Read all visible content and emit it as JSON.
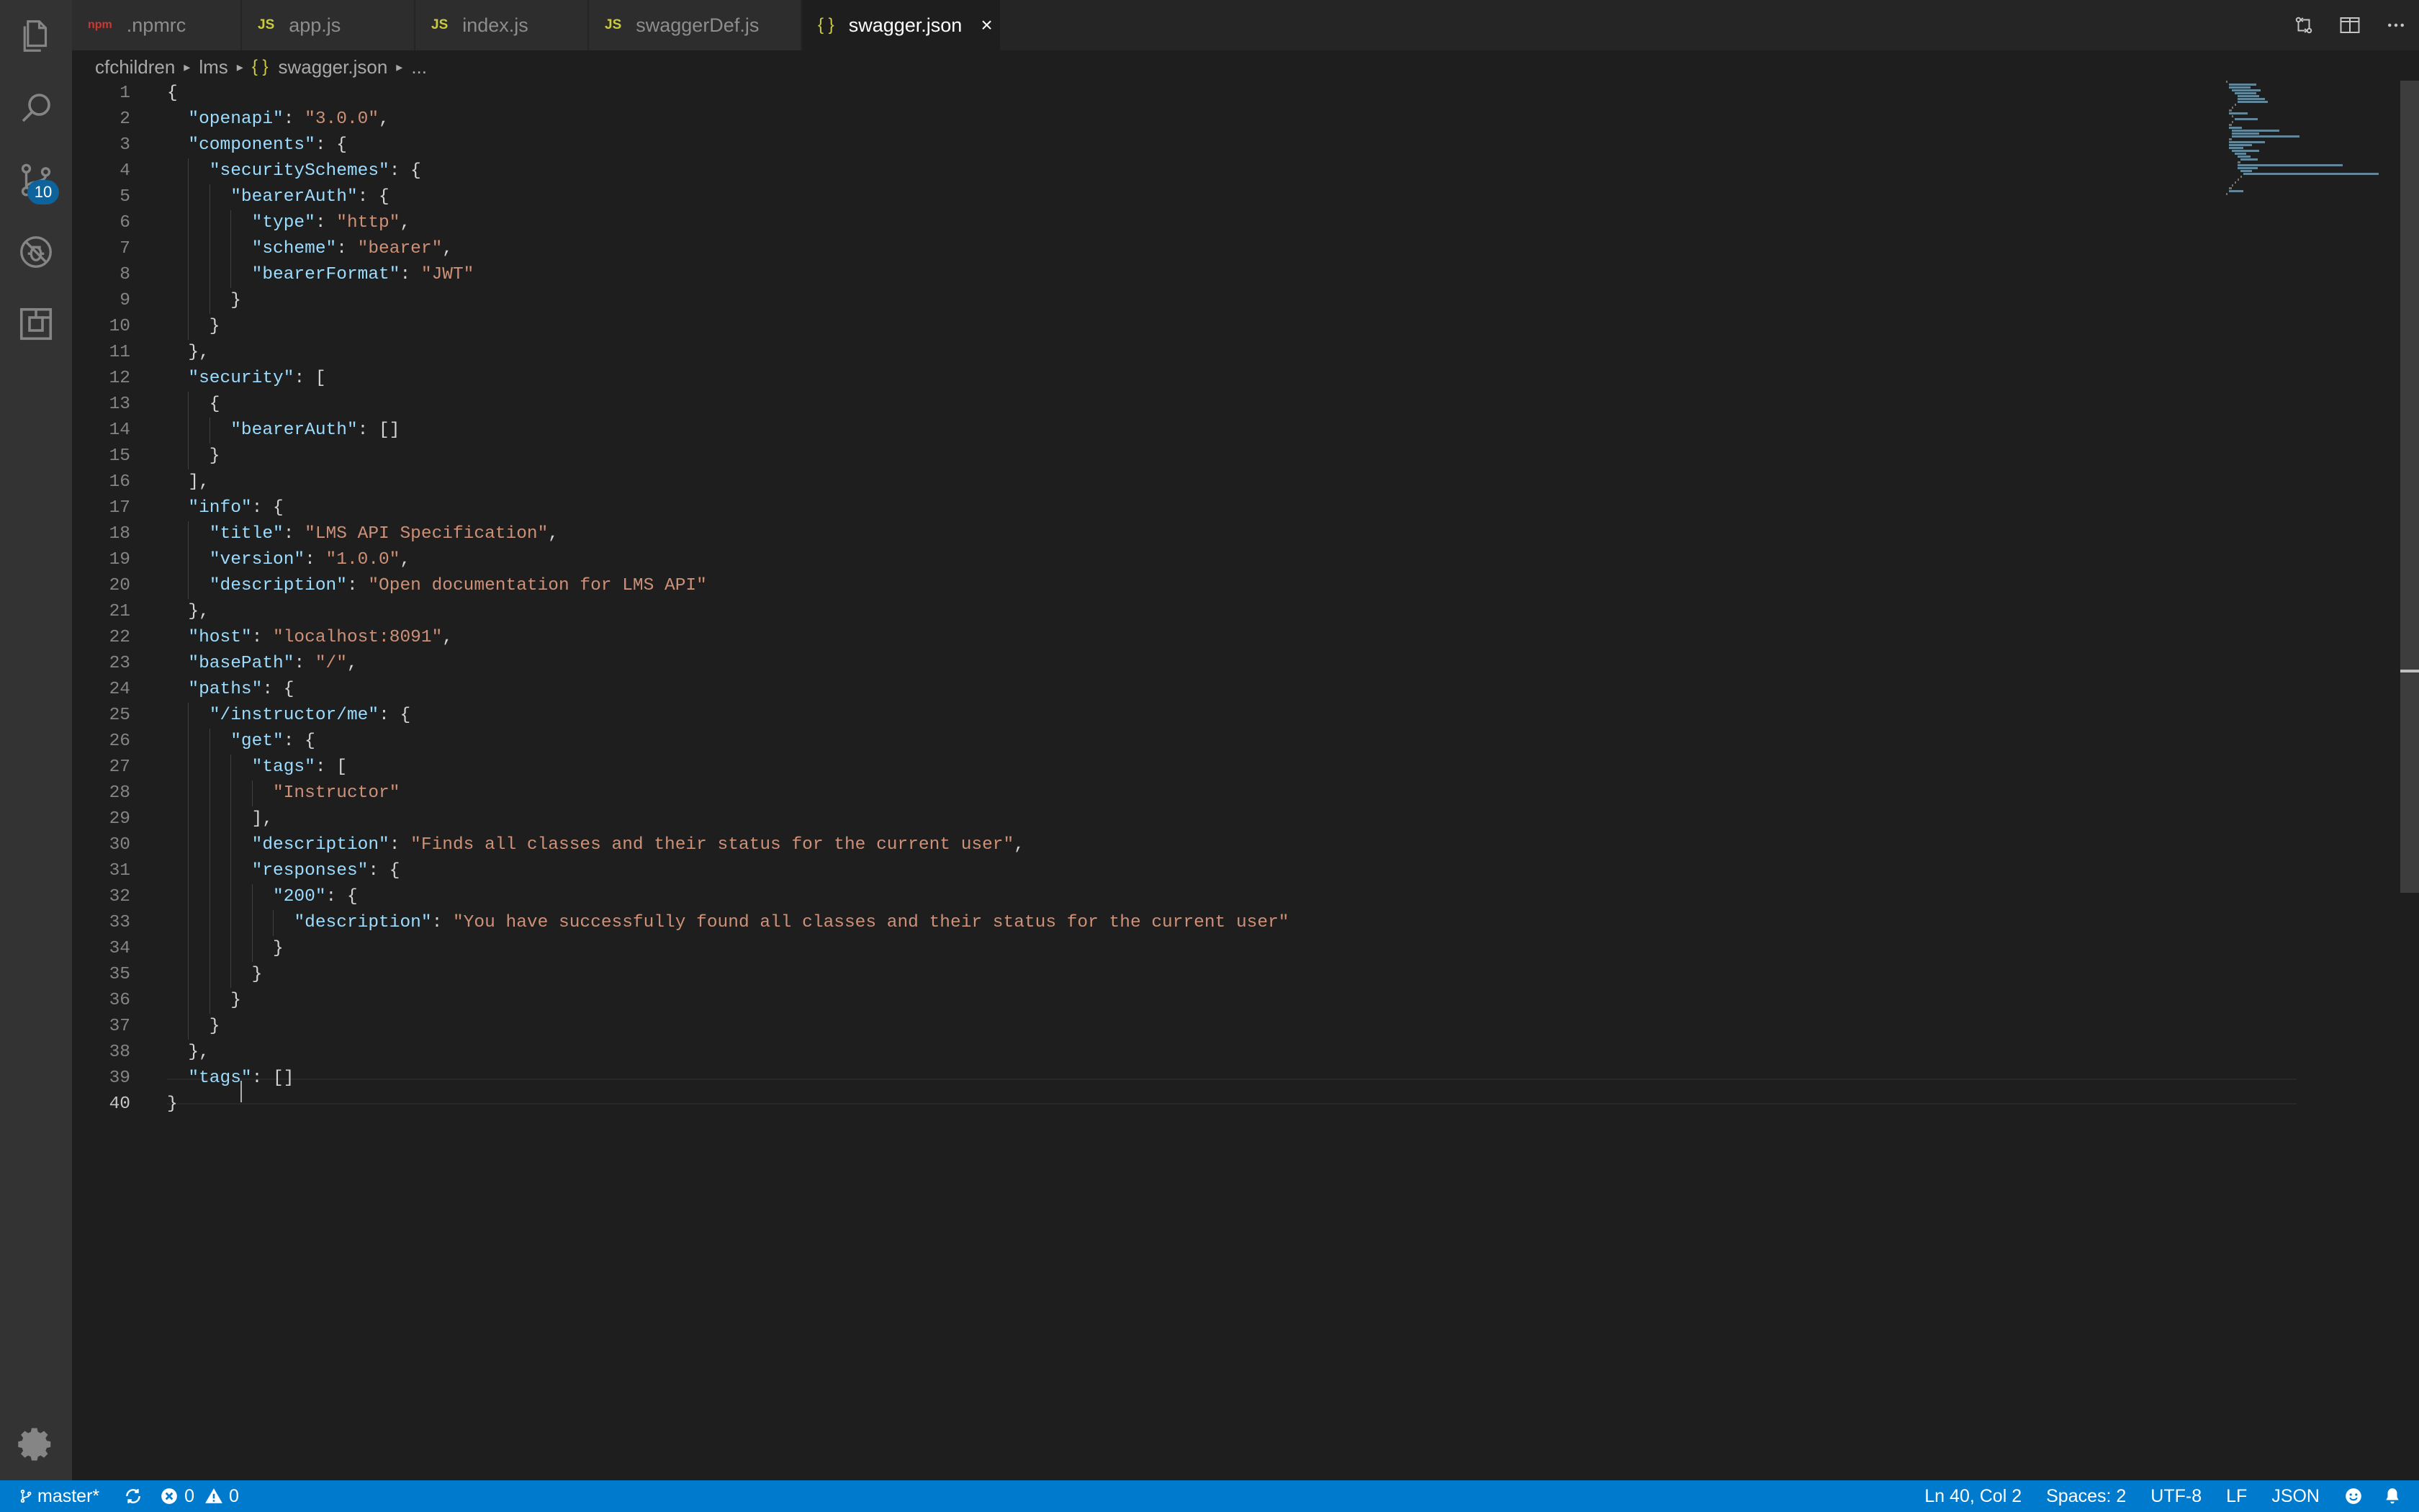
{
  "activity_bar": {
    "items": [
      {
        "name": "explorer-icon"
      },
      {
        "name": "search-icon"
      },
      {
        "name": "source-control-icon"
      },
      {
        "name": "debug-icon"
      },
      {
        "name": "extensions-icon"
      }
    ],
    "scm_badge": "10",
    "settings": {
      "name": "gear-icon"
    }
  },
  "tabs": [
    {
      "label": ".npmrc",
      "icon": "npm",
      "active": false
    },
    {
      "label": "app.js",
      "icon": "JS",
      "active": false
    },
    {
      "label": "index.js",
      "icon": "JS",
      "active": false
    },
    {
      "label": "swaggerDef.js",
      "icon": "JS",
      "active": false
    },
    {
      "label": "swagger.json",
      "icon": "{ }",
      "active": true
    }
  ],
  "tab_close": "×",
  "breadcrumb": {
    "items": [
      "cfchildren",
      "lms",
      "swagger.json",
      "..."
    ],
    "json_icon": "{ }"
  },
  "editor": {
    "language": "json",
    "current_line": 40,
    "lines": [
      "{",
      "  \"openapi\": \"3.0.0\",",
      "  \"components\": {",
      "    \"securitySchemes\": {",
      "      \"bearerAuth\": {",
      "        \"type\": \"http\",",
      "        \"scheme\": \"bearer\",",
      "        \"bearerFormat\": \"JWT\"",
      "      }",
      "    }",
      "  },",
      "  \"security\": [",
      "    {",
      "      \"bearerAuth\": []",
      "    }",
      "  ],",
      "  \"info\": {",
      "    \"title\": \"LMS API Specification\",",
      "    \"version\": \"1.0.0\",",
      "    \"description\": \"Open documentation for LMS API\"",
      "  },",
      "  \"host\": \"localhost:8091\",",
      "  \"basePath\": \"/\",",
      "  \"paths\": {",
      "    \"/instructor/me\": {",
      "      \"get\": {",
      "        \"tags\": [",
      "          \"Instructor\"",
      "        ],",
      "        \"description\": \"Finds all classes and their status for the current user\",",
      "        \"responses\": {",
      "          \"200\": {",
      "            \"description\": \"You have successfully found all classes and their status for the current user\"",
      "          }",
      "        }",
      "      }",
      "    }",
      "  },",
      "  \"tags\": []",
      "}"
    ]
  },
  "status_bar": {
    "branch": "master*",
    "errors": "0",
    "warnings": "0",
    "position": "Ln 40, Col 2",
    "spaces": "Spaces: 2",
    "encoding": "UTF-8",
    "eol": "LF",
    "language": "JSON"
  },
  "colors": {
    "accent": "#007acc",
    "key": "#9cdcfe",
    "string": "#ce9178",
    "editor_bg": "#1e1e1e"
  }
}
